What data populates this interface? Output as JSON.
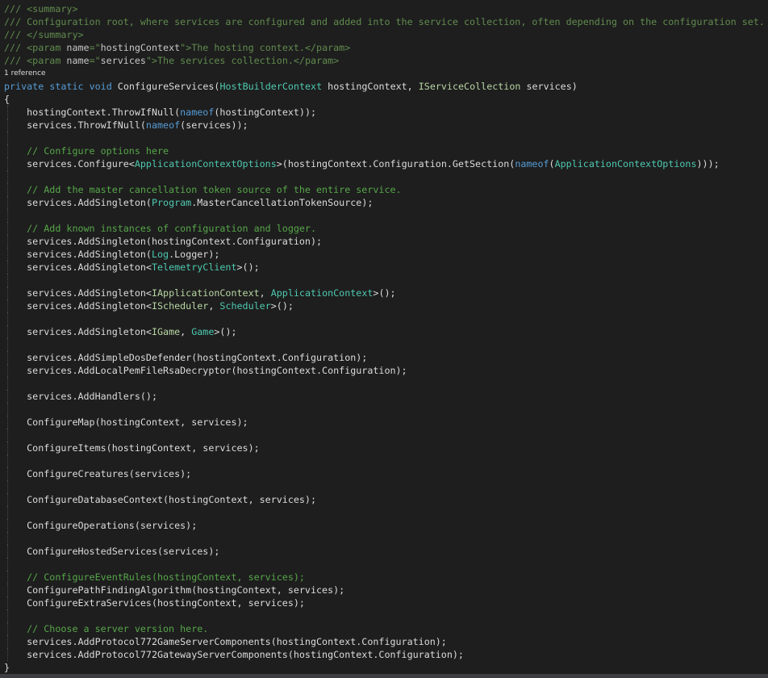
{
  "editor": {
    "language": "csharp",
    "colors": {
      "background": "#1e1e1e",
      "plain": "#dcdcdc",
      "keyword": "#569cd6",
      "type": "#4ec9b0",
      "interface": "#b8d7a3",
      "method": "#dcdcaa",
      "comment": "#57a64a",
      "doc_comment": "#608b4e",
      "string": "#d69d85"
    },
    "lines": [
      {
        "kind": "code",
        "tokens": [
          [
            "doc",
            "/// <summary>"
          ]
        ]
      },
      {
        "kind": "code",
        "tokens": [
          [
            "doc",
            "/// Configuration root, where services are configured and added into the service collection, often depending on the configuration set."
          ]
        ]
      },
      {
        "kind": "code",
        "tokens": [
          [
            "doc",
            "/// </summary>"
          ]
        ]
      },
      {
        "kind": "code",
        "tokens": [
          [
            "doc",
            "/// <param "
          ],
          [
            "docstr",
            "name"
          ],
          [
            "doc",
            "=\""
          ],
          [
            "docstr",
            "hostingContext"
          ],
          [
            "doc",
            "\">The hosting context.</param>"
          ]
        ]
      },
      {
        "kind": "code",
        "tokens": [
          [
            "doc",
            "/// <param "
          ],
          [
            "docstr",
            "name"
          ],
          [
            "doc",
            "=\""
          ],
          [
            "docstr",
            "services"
          ],
          [
            "doc",
            "\">The services collection.</param>"
          ]
        ]
      },
      {
        "kind": "codelens",
        "tokens": [
          [
            "plain",
            "1 reference"
          ]
        ]
      },
      {
        "kind": "code",
        "tokens": [
          [
            "keyword",
            "private"
          ],
          [
            "plain",
            " "
          ],
          [
            "keyword",
            "static"
          ],
          [
            "plain",
            " "
          ],
          [
            "keyword",
            "void"
          ],
          [
            "plain",
            " ConfigureServices("
          ],
          [
            "type",
            "HostBuilderContext"
          ],
          [
            "plain",
            " hostingContext, "
          ],
          [
            "iface",
            "IServiceCollection"
          ],
          [
            "plain",
            " services)"
          ]
        ]
      },
      {
        "kind": "code",
        "tokens": [
          [
            "plain",
            "{"
          ]
        ]
      },
      {
        "kind": "code",
        "guide": true,
        "tokens": [
          [
            "plain",
            "    hostingContext.ThrowIfNull("
          ],
          [
            "keyword",
            "nameof"
          ],
          [
            "plain",
            "(hostingContext));"
          ]
        ]
      },
      {
        "kind": "code",
        "guide": true,
        "tokens": [
          [
            "plain",
            "    services.ThrowIfNull("
          ],
          [
            "keyword",
            "nameof"
          ],
          [
            "plain",
            "(services));"
          ]
        ]
      },
      {
        "kind": "code",
        "guide": true,
        "tokens": [
          [
            "plain",
            ""
          ]
        ]
      },
      {
        "kind": "code",
        "guide": true,
        "tokens": [
          [
            "comment",
            "    // Configure options here"
          ]
        ]
      },
      {
        "kind": "code",
        "guide": true,
        "tokens": [
          [
            "plain",
            "    services.Configure<"
          ],
          [
            "type",
            "ApplicationContextOptions"
          ],
          [
            "plain",
            ">(hostingContext.Configuration.GetSection("
          ],
          [
            "keyword",
            "nameof"
          ],
          [
            "plain",
            "("
          ],
          [
            "type",
            "ApplicationContextOptions"
          ],
          [
            "plain",
            ")));"
          ]
        ]
      },
      {
        "kind": "code",
        "guide": true,
        "tokens": [
          [
            "plain",
            ""
          ]
        ]
      },
      {
        "kind": "code",
        "guide": true,
        "tokens": [
          [
            "comment",
            "    // Add the master cancellation token source of the entire service."
          ]
        ]
      },
      {
        "kind": "code",
        "guide": true,
        "tokens": [
          [
            "plain",
            "    services.AddSingleton("
          ],
          [
            "type",
            "Program"
          ],
          [
            "plain",
            ".MasterCancellationTokenSource);"
          ]
        ]
      },
      {
        "kind": "code",
        "guide": true,
        "tokens": [
          [
            "plain",
            ""
          ]
        ]
      },
      {
        "kind": "code",
        "guide": true,
        "tokens": [
          [
            "comment",
            "    // Add known instances of configuration and logger."
          ]
        ]
      },
      {
        "kind": "code",
        "guide": true,
        "tokens": [
          [
            "plain",
            "    services.AddSingleton(hostingContext.Configuration);"
          ]
        ]
      },
      {
        "kind": "code",
        "guide": true,
        "tokens": [
          [
            "plain",
            "    services.AddSingleton("
          ],
          [
            "type",
            "Log"
          ],
          [
            "plain",
            ".Logger);"
          ]
        ]
      },
      {
        "kind": "code",
        "guide": true,
        "tokens": [
          [
            "plain",
            "    services.AddSingleton<"
          ],
          [
            "type",
            "TelemetryClient"
          ],
          [
            "plain",
            ">();"
          ]
        ]
      },
      {
        "kind": "code",
        "guide": true,
        "tokens": [
          [
            "plain",
            ""
          ]
        ]
      },
      {
        "kind": "code",
        "guide": true,
        "tokens": [
          [
            "plain",
            "    services.AddSingleton<"
          ],
          [
            "iface",
            "IApplicationContext"
          ],
          [
            "plain",
            ", "
          ],
          [
            "type",
            "ApplicationContext"
          ],
          [
            "plain",
            ">();"
          ]
        ]
      },
      {
        "kind": "code",
        "guide": true,
        "tokens": [
          [
            "plain",
            "    services.AddSingleton<"
          ],
          [
            "iface",
            "IScheduler"
          ],
          [
            "plain",
            ", "
          ],
          [
            "type",
            "Scheduler"
          ],
          [
            "plain",
            ">();"
          ]
        ]
      },
      {
        "kind": "code",
        "guide": true,
        "tokens": [
          [
            "plain",
            ""
          ]
        ]
      },
      {
        "kind": "code",
        "guide": true,
        "tokens": [
          [
            "plain",
            "    services.AddSingleton<"
          ],
          [
            "iface",
            "IGame"
          ],
          [
            "plain",
            ", "
          ],
          [
            "type",
            "Game"
          ],
          [
            "plain",
            ">();"
          ]
        ]
      },
      {
        "kind": "code",
        "guide": true,
        "tokens": [
          [
            "plain",
            ""
          ]
        ]
      },
      {
        "kind": "code",
        "guide": true,
        "tokens": [
          [
            "plain",
            "    services.AddSimpleDosDefender(hostingContext.Configuration);"
          ]
        ]
      },
      {
        "kind": "code",
        "guide": true,
        "tokens": [
          [
            "plain",
            "    services.AddLocalPemFileRsaDecryptor(hostingContext.Configuration);"
          ]
        ]
      },
      {
        "kind": "code",
        "guide": true,
        "tokens": [
          [
            "plain",
            ""
          ]
        ]
      },
      {
        "kind": "code",
        "guide": true,
        "tokens": [
          [
            "plain",
            "    services.AddHandlers();"
          ]
        ]
      },
      {
        "kind": "code",
        "guide": true,
        "tokens": [
          [
            "plain",
            ""
          ]
        ]
      },
      {
        "kind": "code",
        "guide": true,
        "tokens": [
          [
            "plain",
            "    ConfigureMap(hostingContext, services);"
          ]
        ]
      },
      {
        "kind": "code",
        "guide": true,
        "tokens": [
          [
            "plain",
            ""
          ]
        ]
      },
      {
        "kind": "code",
        "guide": true,
        "tokens": [
          [
            "plain",
            "    ConfigureItems(hostingContext, services);"
          ]
        ]
      },
      {
        "kind": "code",
        "guide": true,
        "tokens": [
          [
            "plain",
            ""
          ]
        ]
      },
      {
        "kind": "code",
        "guide": true,
        "tokens": [
          [
            "plain",
            "    ConfigureCreatures(services);"
          ]
        ]
      },
      {
        "kind": "code",
        "guide": true,
        "tokens": [
          [
            "plain",
            ""
          ]
        ]
      },
      {
        "kind": "code",
        "guide": true,
        "tokens": [
          [
            "plain",
            "    ConfigureDatabaseContext(hostingContext, services);"
          ]
        ]
      },
      {
        "kind": "code",
        "guide": true,
        "tokens": [
          [
            "plain",
            ""
          ]
        ]
      },
      {
        "kind": "code",
        "guide": true,
        "tokens": [
          [
            "plain",
            "    ConfigureOperations(services);"
          ]
        ]
      },
      {
        "kind": "code",
        "guide": true,
        "tokens": [
          [
            "plain",
            ""
          ]
        ]
      },
      {
        "kind": "code",
        "guide": true,
        "tokens": [
          [
            "plain",
            "    ConfigureHostedServices(services);"
          ]
        ]
      },
      {
        "kind": "code",
        "guide": true,
        "tokens": [
          [
            "plain",
            ""
          ]
        ]
      },
      {
        "kind": "code",
        "guide": true,
        "tokens": [
          [
            "comment",
            "    // ConfigureEventRules(hostingContext, services);"
          ]
        ]
      },
      {
        "kind": "code",
        "guide": true,
        "tokens": [
          [
            "plain",
            "    ConfigurePathFindingAlgorithm(hostingContext, services);"
          ]
        ]
      },
      {
        "kind": "code",
        "guide": true,
        "tokens": [
          [
            "plain",
            "    ConfigureExtraServices(hostingContext, services);"
          ]
        ]
      },
      {
        "kind": "code",
        "guide": true,
        "tokens": [
          [
            "plain",
            ""
          ]
        ]
      },
      {
        "kind": "code",
        "guide": true,
        "tokens": [
          [
            "comment",
            "    // Choose a server version here."
          ]
        ]
      },
      {
        "kind": "code",
        "guide": true,
        "tokens": [
          [
            "plain",
            "    services.AddProtocol772GameServerComponents(hostingContext.Configuration);"
          ]
        ]
      },
      {
        "kind": "code",
        "guide": true,
        "tokens": [
          [
            "plain",
            "    services.AddProtocol772GatewayServerComponents(hostingContext.Configuration);"
          ]
        ]
      },
      {
        "kind": "code",
        "tokens": [
          [
            "plain",
            "}"
          ]
        ]
      }
    ]
  }
}
